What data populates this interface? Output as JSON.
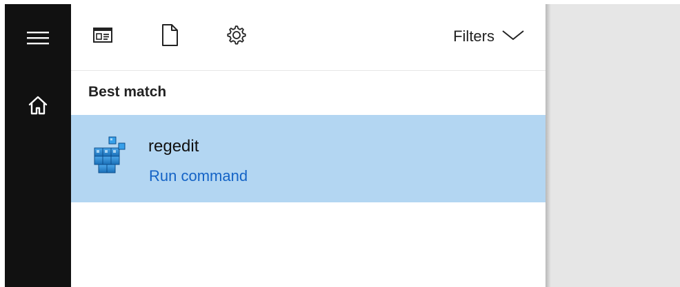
{
  "toolbar": {
    "filters_label": "Filters"
  },
  "results": {
    "section_title": "Best match",
    "best_match": {
      "name": "regedit",
      "subtitle": "Run command"
    }
  },
  "icons": {
    "menu": "hamburger-menu-icon",
    "home": "home-icon",
    "apps": "apps-icon",
    "documents": "document-icon",
    "settings": "gear-icon",
    "filters": "chevron-down-icon",
    "app": "registry-editor-icon"
  },
  "colors": {
    "rail": "#111111",
    "selected_row": "#b3d6f2",
    "link_blue": "#1463c6",
    "right_background": "#e6e6e6"
  }
}
